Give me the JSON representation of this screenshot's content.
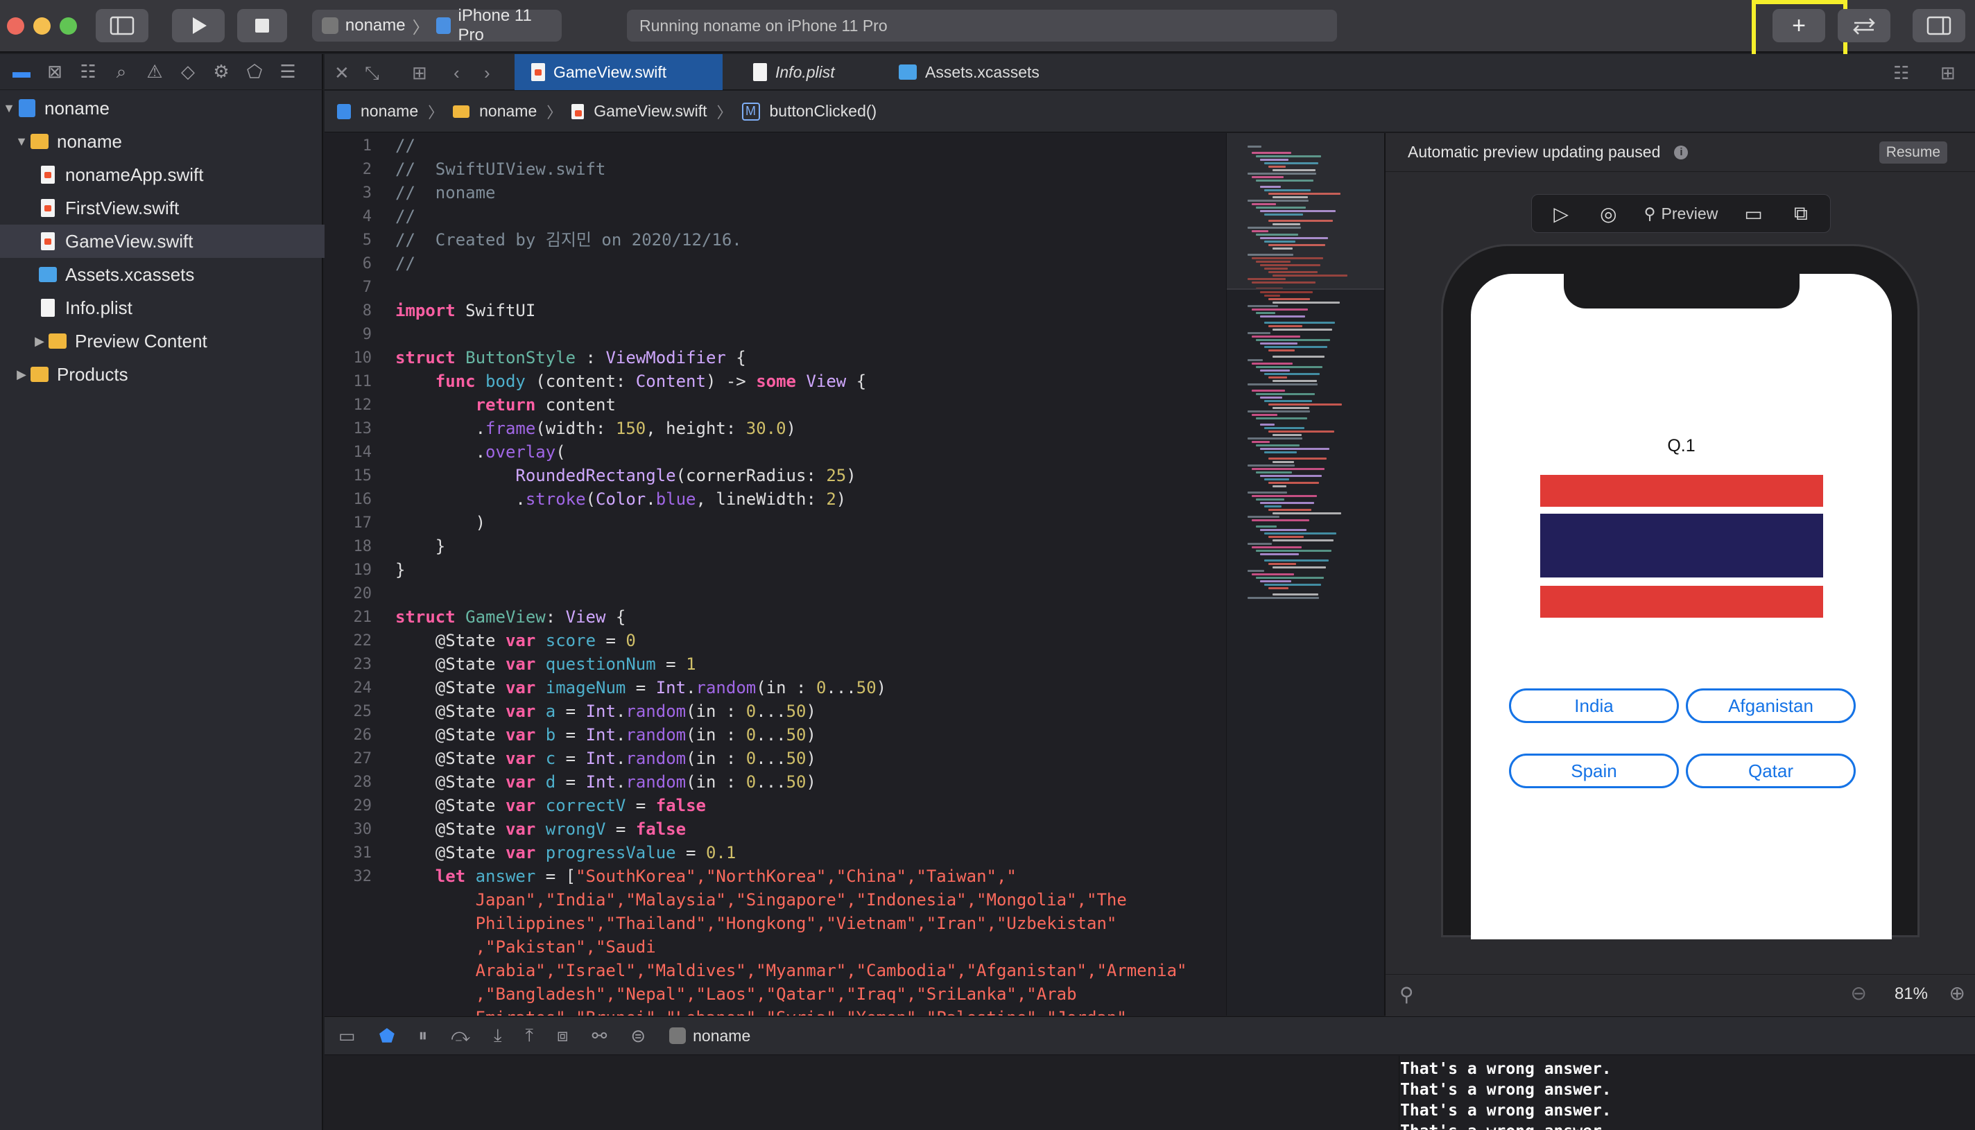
{
  "toolbar": {
    "scheme_name": "noname",
    "device_name": "iPhone 11 Pro",
    "activity_status": "Running noname on iPhone 11 Pro",
    "add_button_icon": "+",
    "traffic_light_colors": [
      "#ed6a5e",
      "#f5bf4f",
      "#61c554"
    ]
  },
  "navigator": {
    "tree": [
      {
        "label": "noname",
        "icon": "project-icon",
        "indent": 0,
        "disclosure": "expanded"
      },
      {
        "label": "noname",
        "icon": "folder-icon",
        "indent": 1,
        "disclosure": "expanded"
      },
      {
        "label": "nonameApp.swift",
        "icon": "swift-file-icon",
        "indent": 2
      },
      {
        "label": "FirstView.swift",
        "icon": "swift-file-icon",
        "indent": 2
      },
      {
        "label": "GameView.swift",
        "icon": "swift-file-icon",
        "indent": 2,
        "selected": true
      },
      {
        "label": "Assets.xcassets",
        "icon": "assets-icon",
        "indent": 2
      },
      {
        "label": "Info.plist",
        "icon": "plist-icon",
        "indent": 2
      },
      {
        "label": "Preview Content",
        "icon": "folder-icon",
        "indent": 2,
        "disclosure": "collapsed"
      },
      {
        "label": "Products",
        "icon": "folder-icon",
        "indent": 1,
        "disclosure": "collapsed"
      }
    ]
  },
  "tabs": [
    {
      "label": "GameView.swift",
      "active": true
    },
    {
      "label": "Info.plist",
      "active": false
    },
    {
      "label": "Assets.xcassets",
      "active": false
    }
  ],
  "jumpbar": [
    "noname",
    "noname",
    "GameView.swift",
    "buttonClicked()"
  ],
  "editor": {
    "line_numbers": [
      "1",
      "2",
      "3",
      "4",
      "5",
      "6",
      "7",
      "8",
      "9",
      "10",
      "11",
      "12",
      "13",
      "14",
      "15",
      "16",
      "17",
      "18",
      "19",
      "20",
      "21",
      "22",
      "23",
      "24",
      "25",
      "26",
      "27",
      "28",
      "29",
      "30",
      "31",
      "32"
    ]
  },
  "canvas": {
    "status_text": "Automatic preview updating paused",
    "resume_label": "Resume",
    "preview_label": "Preview",
    "question_label": "Q.1",
    "flag_colors": [
      "#e03a36",
      "#221f5a",
      "#e03a36"
    ],
    "answers": [
      "India",
      "Afganistan",
      "Spain",
      "Qatar"
    ],
    "zoom_level": "81%"
  },
  "debug": {
    "target_name": "noname"
  },
  "console": {
    "lines": [
      "That's a wrong answer.",
      "That's a wrong answer.",
      "That's a wrong answer.",
      "That's a wrong answer."
    ]
  }
}
